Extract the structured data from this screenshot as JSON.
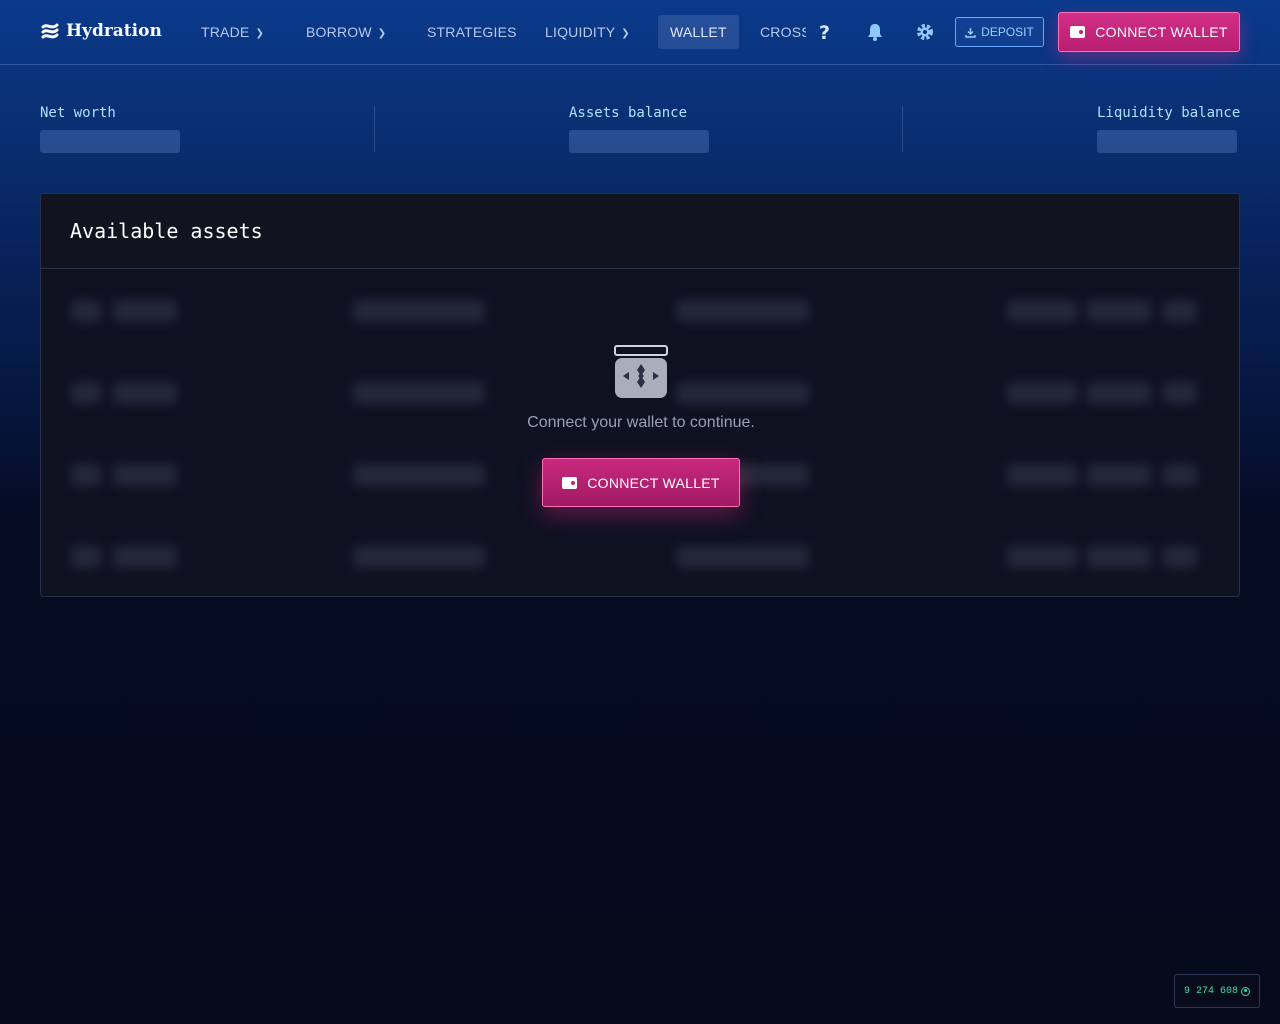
{
  "header": {
    "logo_text": "Hydration",
    "nav": {
      "trade": "TRADE",
      "borrow": "BORROW",
      "strategies": "STRATEGIES",
      "liquidity": "LIQUIDITY",
      "wallet": "WALLET",
      "cross": "CROSS"
    },
    "icons": [
      "help-icon",
      "bell-icon",
      "gear-icon"
    ],
    "deposit_label": "DEPOSIT",
    "connect_label": "CONNECT WALLET",
    "active_tab": "WALLET"
  },
  "stats": {
    "net_worth_label": "Net worth",
    "assets_balance_label": "Assets balance",
    "liquidity_balance_label": "Liquidity balance"
  },
  "assets_card": {
    "title": "Available assets",
    "message": "Connect your wallet to continue.",
    "connect_label": "CONNECT WALLET"
  },
  "status": {
    "block_number": "9 274 608"
  },
  "colors": {
    "accent_pink": "#d22f87",
    "accent_blue": "#6aa5ff",
    "status_green": "#3ce0a0"
  }
}
